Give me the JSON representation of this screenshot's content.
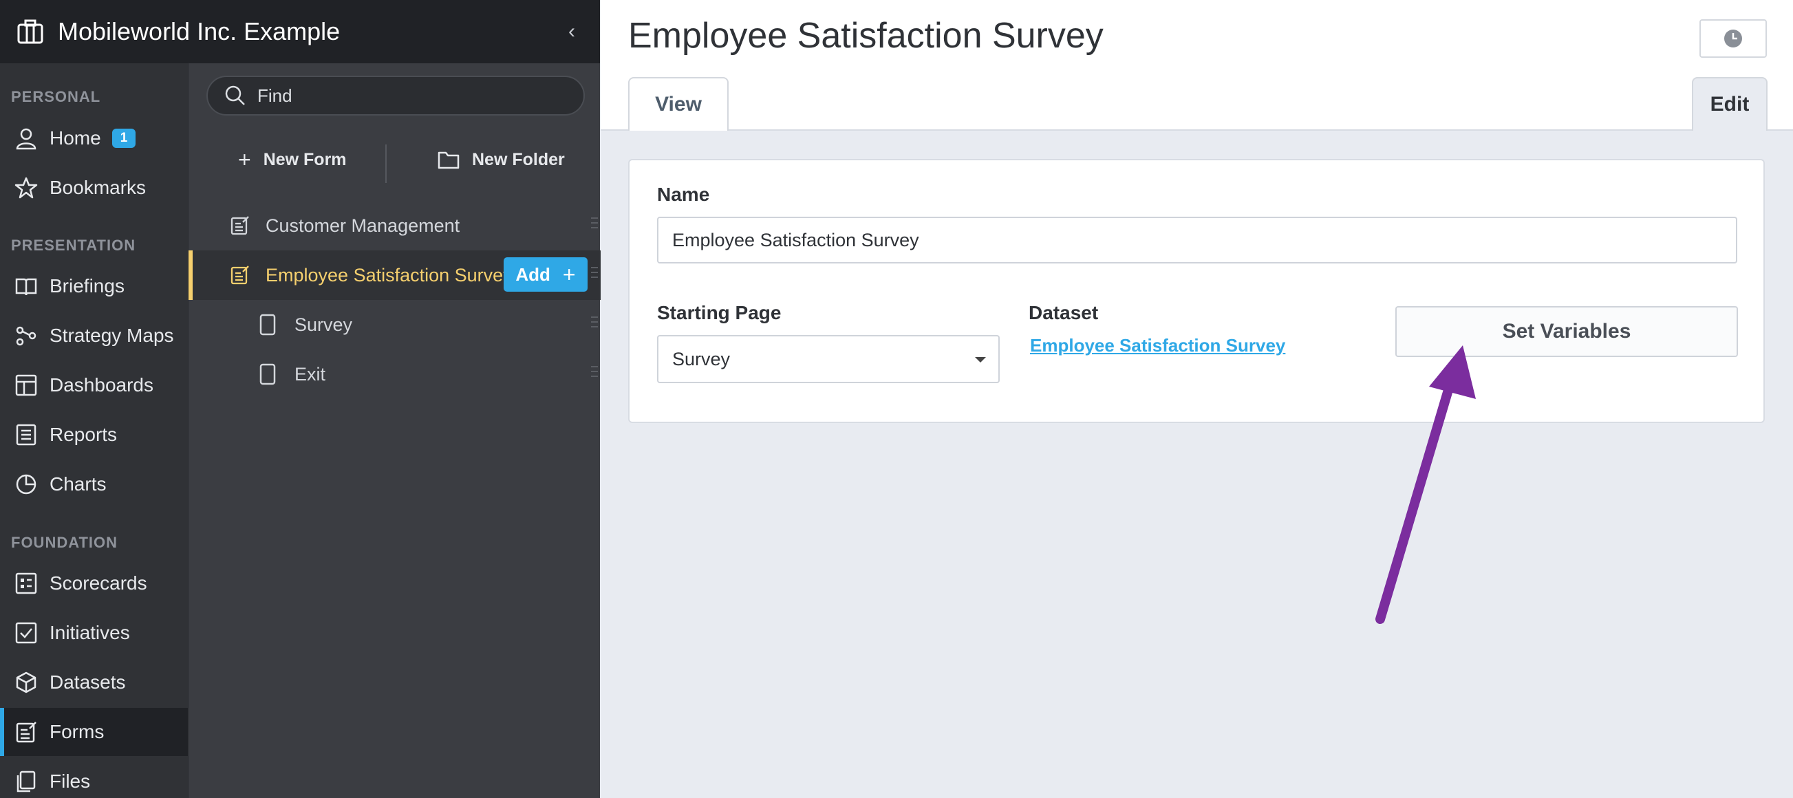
{
  "org": {
    "name": "Mobileworld Inc. Example"
  },
  "nav": {
    "sections": {
      "personal": "PERSONAL",
      "presentation": "PRESENTATION",
      "foundation": "FOUNDATION"
    },
    "items": [
      {
        "label": "Home",
        "icon": "user-icon",
        "badge": "1"
      },
      {
        "label": "Bookmarks",
        "icon": "star-icon"
      },
      {
        "label": "Briefings",
        "icon": "book-icon"
      },
      {
        "label": "Strategy Maps",
        "icon": "strategy-map-icon"
      },
      {
        "label": "Dashboards",
        "icon": "dashboard-icon"
      },
      {
        "label": "Reports",
        "icon": "report-icon"
      },
      {
        "label": "Charts",
        "icon": "pie-chart-icon"
      },
      {
        "label": "Scorecards",
        "icon": "scorecard-icon"
      },
      {
        "label": "Initiatives",
        "icon": "checkbox-icon"
      },
      {
        "label": "Datasets",
        "icon": "cube-icon"
      },
      {
        "label": "Forms",
        "icon": "form-icon"
      },
      {
        "label": "Files",
        "icon": "files-icon"
      }
    ]
  },
  "panel": {
    "search_placeholder": "Find",
    "new_form": "New Form",
    "new_folder": "New Folder",
    "add_label": "Add",
    "tree": [
      {
        "label": "Customer Management"
      },
      {
        "label": "Employee Satisfaction Survey"
      },
      {
        "label": "Survey"
      },
      {
        "label": "Exit"
      }
    ]
  },
  "main": {
    "title": "Employee Satisfaction Survey",
    "tabs": {
      "view": "View",
      "edit": "Edit"
    },
    "form": {
      "name_label": "Name",
      "name_value": "Employee Satisfaction Survey",
      "starting_page_label": "Starting Page",
      "starting_page_value": "Survey",
      "dataset_label": "Dataset",
      "dataset_value": "Employee Satisfaction Survey",
      "set_variables": "Set Variables"
    }
  },
  "colors": {
    "accent": "#2fa8e6",
    "selected": "#f6d06e",
    "annotation_arrow": "#7b2d9e"
  }
}
